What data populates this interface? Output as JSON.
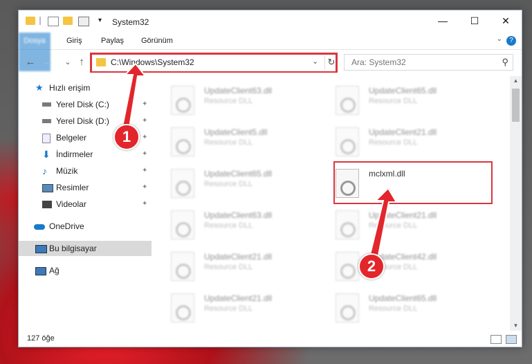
{
  "window": {
    "title": "System32",
    "minimize_glyph": "—",
    "maximize_glyph": "☐",
    "close_glyph": "✕"
  },
  "ribbon": {
    "tabs": [
      "Dosya",
      "Giriş",
      "Paylaş",
      "Görünüm"
    ],
    "expand_glyph": "⌄",
    "help_glyph": "?"
  },
  "nav": {
    "back_glyph": "←",
    "forward_glyph": "→",
    "recent_glyph": "⌄",
    "up_glyph": "↑",
    "address": "C:\\Windows\\System32",
    "address_dropdown_glyph": "⌄",
    "refresh_glyph": "↻",
    "search_placeholder": "Ara: System32",
    "search_glyph": "⚲"
  },
  "sidebar": {
    "pin_glyph": "✦",
    "items": [
      {
        "label": "Hızlı erişim",
        "icon": "star-icon",
        "color": "#1979ca"
      },
      {
        "label": "Yerel Disk (C:)",
        "icon": "drive-icon",
        "color": "#7a7a7a"
      },
      {
        "label": "Yerel Disk (D:)",
        "icon": "drive-icon",
        "color": "#7a7a7a"
      },
      {
        "label": "Belgeler",
        "icon": "documents-icon",
        "color": "#9aa9b8"
      },
      {
        "label": "İndirmeler",
        "icon": "download-icon",
        "color": "#1979ca"
      },
      {
        "label": "Müzik",
        "icon": "music-icon",
        "color": "#1979ca"
      },
      {
        "label": "Resimler",
        "icon": "pictures-icon",
        "color": "#5a8ab8"
      },
      {
        "label": "Videolar",
        "icon": "videos-icon",
        "color": "#444444"
      },
      {
        "label": "OneDrive",
        "icon": "cloud-icon",
        "color": "#1979ca"
      },
      {
        "label": "Bu bilgisayar",
        "icon": "computer-icon",
        "color": "#3d7ab8"
      },
      {
        "label": "Ağ",
        "icon": "network-icon",
        "color": "#3d7ab8"
      }
    ]
  },
  "files": [
    {
      "name": "UpdateClient63.dll",
      "type": "Resource DLL"
    },
    {
      "name": "UpdateClient65.dll",
      "type": "Resource DLL"
    },
    {
      "name": "UpdateClient5.dll",
      "type": "Resource DLL"
    },
    {
      "name": "UpdateClient21.dll",
      "type": "Resource DLL"
    },
    {
      "name": "UpdateClient65.dll",
      "type": "Resource DLL"
    },
    {
      "name": "mclxml.dll",
      "type": ""
    },
    {
      "name": "UpdateClient63.dll",
      "type": "Resource DLL"
    },
    {
      "name": "UpdateClient21.dll",
      "type": "Resource DLL"
    },
    {
      "name": "UpdateClient21.dll",
      "type": "Resource DLL"
    },
    {
      "name": "UpdateClient42.dll",
      "type": "Resource DLL"
    },
    {
      "name": "UpdateClient21.dll",
      "type": "Resource DLL"
    },
    {
      "name": "UpdateClient65.dll",
      "type": "Resource DLL"
    }
  ],
  "status": {
    "item_count": "127 öğe"
  },
  "annotations": {
    "step1": "1",
    "step2": "2",
    "color": "#e2262b"
  },
  "scroll": {
    "up_glyph": "▲",
    "down_glyph": "▼"
  }
}
